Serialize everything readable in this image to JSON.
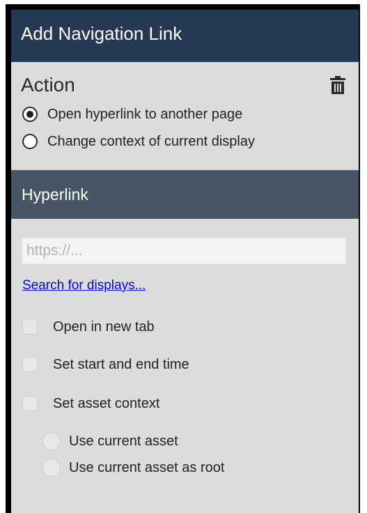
{
  "dialog": {
    "title": "Add Navigation Link"
  },
  "action": {
    "heading": "Action",
    "delete_icon": "trash-icon",
    "options": [
      {
        "label": "Open hyperlink to another page",
        "selected": true
      },
      {
        "label": "Change context of current display",
        "selected": false
      }
    ]
  },
  "hyperlink": {
    "section_title": "Hyperlink",
    "url_placeholder": "https://...",
    "url_value": "",
    "search_link": "Search for displays...",
    "checkboxes": [
      {
        "label": "Open in new tab",
        "checked": false
      },
      {
        "label": "Set start and end time",
        "checked": false
      },
      {
        "label": "Set asset context",
        "checked": false
      }
    ],
    "asset_options": [
      {
        "label": "Use current asset",
        "selected": false
      },
      {
        "label": "Use current asset as root",
        "selected": false
      }
    ]
  },
  "colors": {
    "title_bar": "#253954",
    "section_bar": "#465667",
    "panel_bg": "#dcdcdc",
    "link": "#0000ee"
  }
}
